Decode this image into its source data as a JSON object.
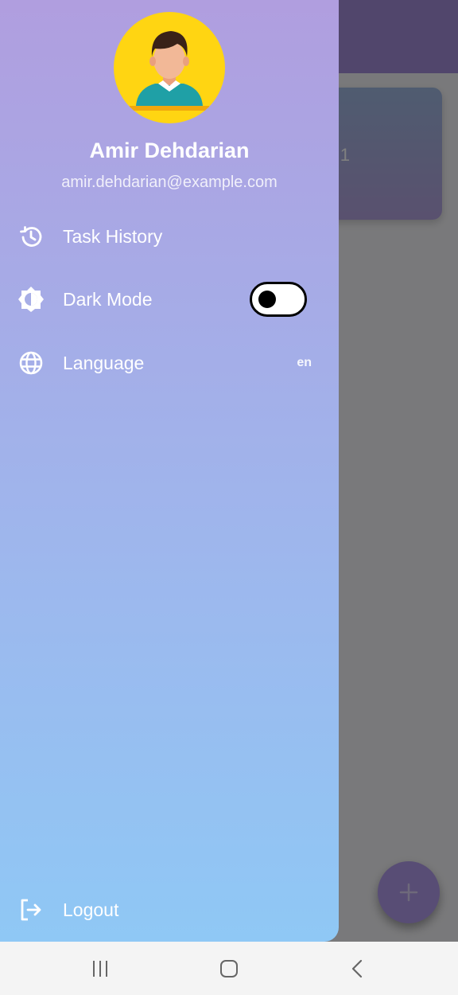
{
  "background_app": {
    "card_text": "1",
    "fab_icon": "plus-icon"
  },
  "drawer": {
    "avatar_icon": "user-avatar-icon",
    "user": {
      "name": "Amir Dehdarian",
      "email": "amir.dehdarian@example.com"
    },
    "menu": [
      {
        "icon": "history-icon",
        "label": "Task History"
      },
      {
        "icon": "brightness-icon",
        "label": "Dark Mode",
        "toggle_on": false
      },
      {
        "icon": "globe-icon",
        "label": "Language",
        "value": "en"
      }
    ],
    "logout": {
      "icon": "logout-icon",
      "label": "Logout"
    }
  },
  "system_nav": {
    "buttons": [
      "recent-apps-icon",
      "home-icon",
      "back-icon"
    ]
  },
  "colors": {
    "drawer_gradient_top": "#b09edf",
    "drawer_gradient_bottom": "#8fc8f5",
    "avatar_background": "#ffd512",
    "fab": "#b19bea"
  }
}
